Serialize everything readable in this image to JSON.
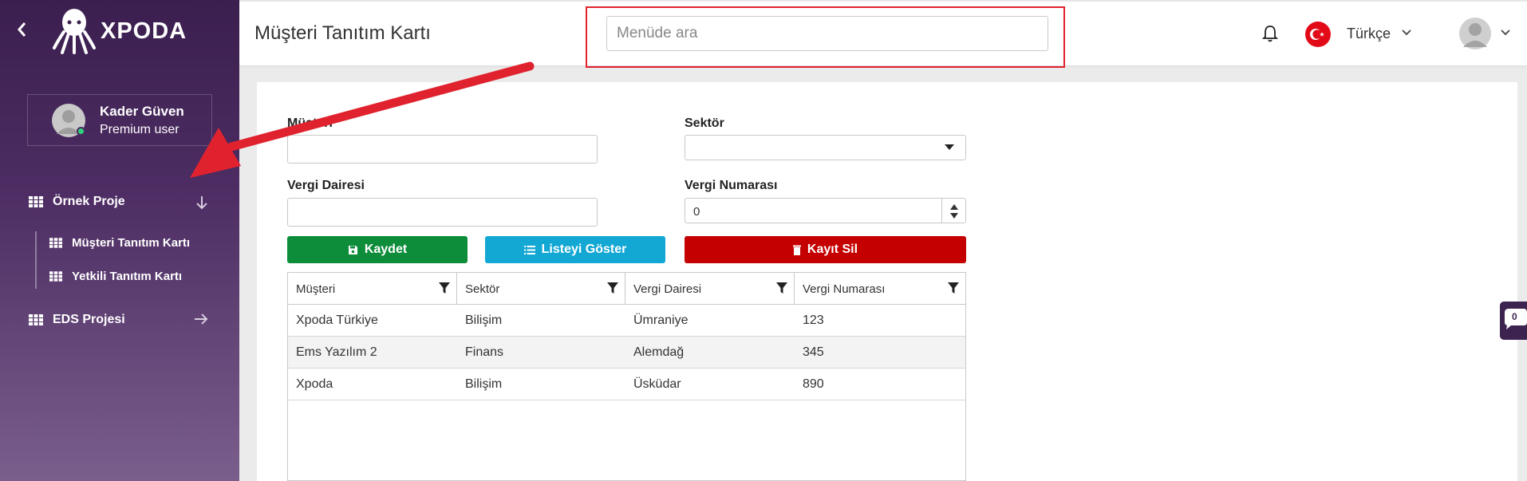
{
  "sidebar": {
    "logo_text": "XPODA",
    "user": {
      "name": "Kader Güven",
      "role": "Premium user"
    },
    "menu": [
      {
        "label": "Örnek Proje",
        "children": [
          {
            "label": "Müşteri Tanıtım Kartı"
          },
          {
            "label": "Yetkili Tanıtım Kartı"
          }
        ]
      },
      {
        "label": "EDS Projesi"
      }
    ]
  },
  "header": {
    "title": "Müşteri Tanıtım Kartı",
    "search_placeholder": "Menüde ara",
    "language": "Türkçe"
  },
  "form": {
    "musteri_label": "Müşteri",
    "sektor_label": "Sektör",
    "vergi_dairesi_label": "Vergi Dairesi",
    "vergi_numarasi_label": "Vergi Numarası",
    "vergi_numarasi_value": "0"
  },
  "buttons": {
    "save": "Kaydet",
    "list": "Listeyi Göster",
    "delete": "Kayıt Sil"
  },
  "table": {
    "columns": [
      "Müşteri",
      "Sektör",
      "Vergi Dairesi",
      "Vergi Numarası"
    ],
    "rows": [
      [
        "Xpoda Türkiye",
        "Bilişim",
        "Ümraniye",
        "123"
      ],
      [
        "Ems Yazılım 2",
        "Finans",
        "Alemdağ",
        "345"
      ],
      [
        "Xpoda",
        "Bilişim",
        "Üsküdar",
        "890"
      ]
    ]
  },
  "chat": {
    "badge": "0"
  },
  "colors": {
    "save": "#0d8c3a",
    "list": "#13a8d4",
    "delete": "#c40000",
    "highlight": "#e0222e",
    "sidebar_top": "#3b1f4f"
  }
}
